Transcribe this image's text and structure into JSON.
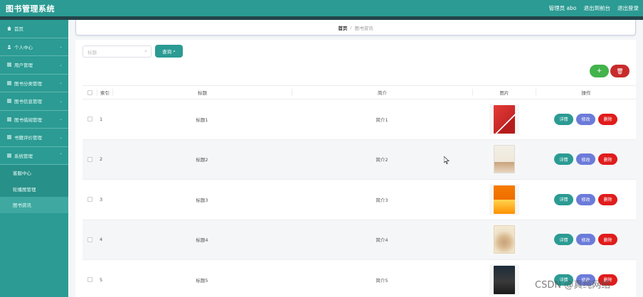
{
  "header": {
    "brand": "图书管理系统",
    "links": [
      "管理员 abo",
      "退出到前台",
      "退出登录"
    ]
  },
  "sidebar": {
    "items": [
      {
        "label": "首页"
      },
      {
        "label": "个人中心"
      },
      {
        "label": "用户管理"
      },
      {
        "label": "图书分类管理"
      },
      {
        "label": "图书信息管理"
      },
      {
        "label": "图书借阅管理"
      },
      {
        "label": "书籍评价管理"
      },
      {
        "label": "系统管理"
      }
    ],
    "sub_items": [
      {
        "label": "客服中心"
      },
      {
        "label": "轮播图管理"
      },
      {
        "label": "图书资讯"
      }
    ]
  },
  "breadcrumb": {
    "home": "首页",
    "sep": "/",
    "current": "图书资讯"
  },
  "search": {
    "placeholder": "标题",
    "button": "查询"
  },
  "toolbar": {
    "add": "+",
    "delete": "🗑"
  },
  "table": {
    "headers": [
      "索引",
      "标题",
      "简介",
      "图片",
      "操作"
    ],
    "rows": [
      {
        "idx": "1",
        "title": "标题1",
        "intro": "简介1"
      },
      {
        "idx": "2",
        "title": "标题2",
        "intro": "简介2"
      },
      {
        "idx": "3",
        "title": "标题3",
        "intro": "简介3"
      },
      {
        "idx": "4",
        "title": "标题4",
        "intro": "简介4"
      },
      {
        "idx": "5",
        "title": "标题5",
        "intro": "简介5"
      }
    ],
    "ops": {
      "detail": "详情",
      "edit": "修改",
      "delete": "删除"
    }
  },
  "watermark": "CSDN @真纯网络",
  "colors": {
    "primary": "#2b9b93",
    "danger": "#e01c1c",
    "edit": "#6c7bd9",
    "add": "#43b34c"
  }
}
